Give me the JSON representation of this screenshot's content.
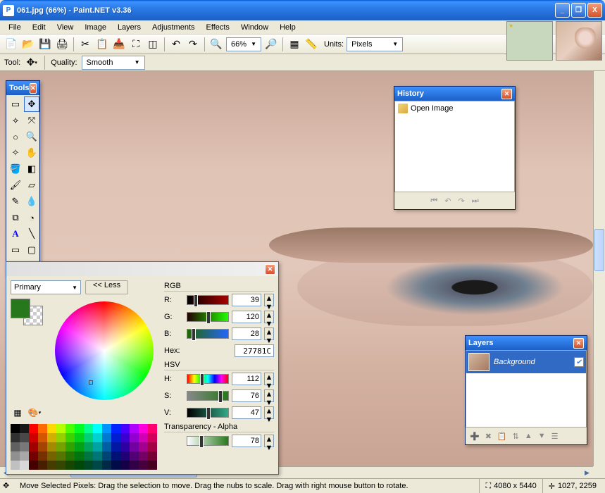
{
  "title": "061.jpg (66%) - Paint.NET v3.36",
  "window_buttons": {
    "min": "_",
    "max": "❐",
    "close": "X"
  },
  "menu": [
    "File",
    "Edit",
    "View",
    "Image",
    "Layers",
    "Adjustments",
    "Effects",
    "Window",
    "Help"
  ],
  "toolbar": {
    "zoom_value": "66%",
    "units_label": "Units:",
    "units_value": "Pixels"
  },
  "tool_options": {
    "tool_label": "Tool:",
    "quality_label": "Quality:",
    "quality_value": "Smooth"
  },
  "tools_panel": {
    "title": "Tools",
    "tools": [
      {
        "name": "rectangle-select",
        "glyph": "▭"
      },
      {
        "name": "move-selected",
        "glyph": "✥"
      },
      {
        "name": "lasso-select",
        "glyph": "⟡"
      },
      {
        "name": "move-selection",
        "glyph": "⤧"
      },
      {
        "name": "ellipse-select",
        "glyph": "○"
      },
      {
        "name": "zoom",
        "glyph": "🔍"
      },
      {
        "name": "magic-wand",
        "glyph": "✧"
      },
      {
        "name": "pan",
        "glyph": "✋"
      },
      {
        "name": "paint-bucket",
        "glyph": "🪣"
      },
      {
        "name": "gradient",
        "glyph": "◧"
      },
      {
        "name": "paintbrush",
        "glyph": "🖌"
      },
      {
        "name": "eraser",
        "glyph": "▱"
      },
      {
        "name": "pencil",
        "glyph": "✎"
      },
      {
        "name": "color-picker",
        "glyph": "💧"
      },
      {
        "name": "clone-stamp",
        "glyph": "⧉"
      },
      {
        "name": "recolor",
        "glyph": "◔"
      },
      {
        "name": "text",
        "glyph": "A"
      },
      {
        "name": "line",
        "glyph": "╲"
      },
      {
        "name": "rectangle",
        "glyph": "▭"
      },
      {
        "name": "rounded-rect",
        "glyph": "▢"
      },
      {
        "name": "ellipse",
        "glyph": "◯"
      },
      {
        "name": "freeform",
        "glyph": "⌓"
      }
    ],
    "selected_index": 1
  },
  "history_panel": {
    "title": "History",
    "items": [
      {
        "label": "Open Image"
      }
    ],
    "controls": [
      "⏮",
      "↶",
      "↷",
      "⏭"
    ]
  },
  "layers_panel": {
    "title": "Layers",
    "items": [
      {
        "label": "Background",
        "visible": true
      }
    ],
    "controls": [
      "➕",
      "✖",
      "📋",
      "⇅",
      "▲",
      "▼",
      "☰"
    ]
  },
  "colors_panel": {
    "primary_dropdown": "Primary",
    "less_button": "<< Less",
    "rgb_label": "RGB",
    "hsv_label": "HSV",
    "r_label": "R:",
    "g_label": "G:",
    "b_label": "B:",
    "h_label": "H:",
    "s_label": "S:",
    "v_label": "V:",
    "hex_label": "Hex:",
    "transparency_label": "Transparency - Alpha",
    "values": {
      "r": 39,
      "g": 120,
      "b": 28,
      "h": 112,
      "s": 76,
      "v": 47,
      "hex": "27781C",
      "alpha": 78
    },
    "primary_color": "#27781C"
  },
  "status": {
    "main": "Move Selected Pixels: Drag the selection to move. Drag the nubs to scale. Drag with right mouse button to rotate.",
    "size": "4080 x 5440",
    "pos": "1027, 2259"
  }
}
